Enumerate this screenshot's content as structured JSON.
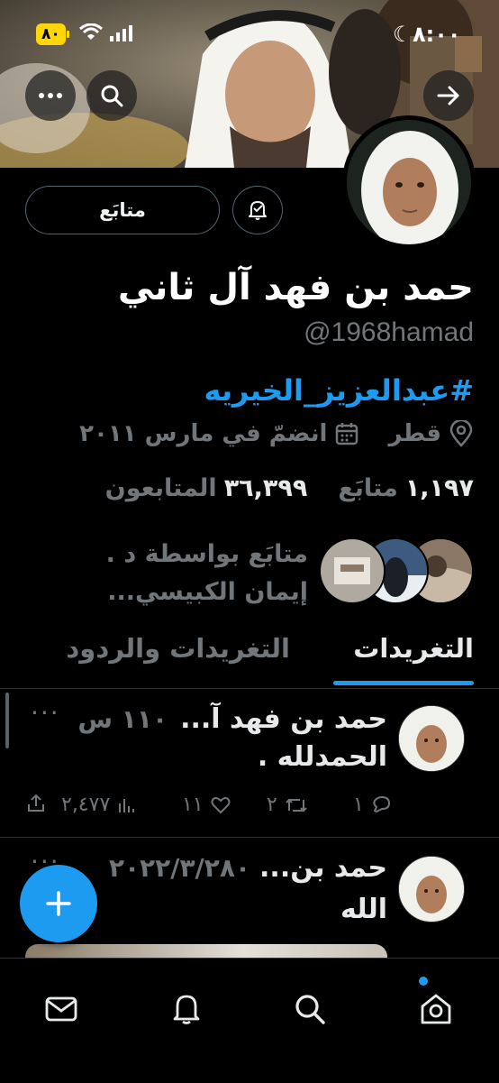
{
  "status_bar": {
    "time": "٨:٠٠",
    "battery": "٨٠"
  },
  "profile": {
    "follow_label": "متابَع",
    "name": "حمد بن فهد آل ثاني",
    "handle": "@1968hamad",
    "bio_hashtag": "#عبدالعزيز_الخيريه",
    "location": "قطر",
    "joined": "انضمّ في مارس ٢٠١١",
    "following_count": "١,١٩٧",
    "following_label": "متابَع",
    "followers_count": "٣٦,٣٩٩",
    "followers_label": "المتابعون",
    "followed_by_line1": "متابَع بواسطة د .",
    "followed_by_line2": "إيمان الكبيسي..."
  },
  "tabs": [
    {
      "label": "التغريدات",
      "active": true
    },
    {
      "label": "التغريدات والردود",
      "active": false
    }
  ],
  "tweets": [
    {
      "name": "حمد بن فهد آ...",
      "time": "١١٠ س",
      "body": "الحمدلله .",
      "replies": "١",
      "retweets": "٢",
      "likes": "١١",
      "views": "٢,٤٧٧"
    },
    {
      "name": "حمد بن...",
      "time": "٢٠٢٢/٣/٢٨٠",
      "body": "الله"
    }
  ],
  "colors": {
    "accent": "#1d9bf0",
    "background": "#000000",
    "muted": "#71767b",
    "notification_dot": "#1d9bf0"
  },
  "icons": {
    "more": "ellipsis-icon",
    "search": "search-icon",
    "forward": "arrow-right-icon",
    "notify": "bell-check-icon",
    "location": "location-pin-icon",
    "calendar": "calendar-icon",
    "nav": [
      "messages-icon",
      "bell-icon",
      "search-icon",
      "home-icon"
    ]
  }
}
